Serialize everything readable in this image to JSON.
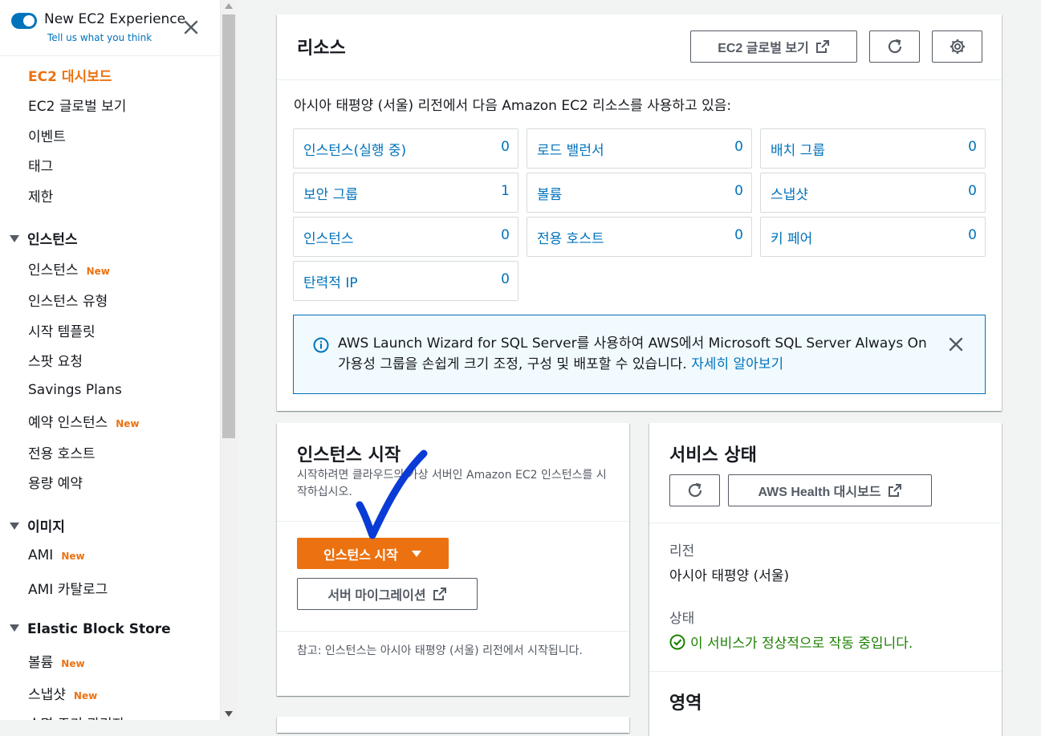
{
  "sidebar": {
    "experience_title": "New EC2 Experience",
    "experience_link": "Tell us what you think",
    "top_items": [
      "EC2 대시보드",
      "EC2 글로벌 보기",
      "이벤트",
      "태그",
      "제한"
    ],
    "section_instances": "인스턴스",
    "instances_items": [
      {
        "label": "인스턴스",
        "badge": "New"
      },
      {
        "label": "인스턴스 유형",
        "badge": ""
      },
      {
        "label": "시작 템플릿",
        "badge": ""
      },
      {
        "label": "스팟 요청",
        "badge": ""
      },
      {
        "label": "Savings Plans",
        "badge": ""
      },
      {
        "label": "예약 인스턴스",
        "badge": "New"
      },
      {
        "label": "전용 호스트",
        "badge": ""
      },
      {
        "label": "용량 예약",
        "badge": ""
      }
    ],
    "section_images": "이미지",
    "images_items": [
      {
        "label": "AMI",
        "badge": "New"
      },
      {
        "label": "AMI 카탈로그",
        "badge": ""
      }
    ],
    "section_ebs": "Elastic Block Store",
    "ebs_items": [
      {
        "label": "볼륨",
        "badge": "New"
      },
      {
        "label": "스냅샷",
        "badge": "New"
      },
      {
        "label": "수명 주기 관리자",
        "badge": ""
      }
    ]
  },
  "resources": {
    "title": "리소스",
    "global_view_button": "EC2 글로벌 보기",
    "description": "아시아 태평양 (서울) 리전에서 다음 Amazon EC2 리소스를 사용하고 있음:",
    "cells": [
      {
        "label": "인스턴스(실행 중)",
        "value": "0"
      },
      {
        "label": "로드 밸런서",
        "value": "0"
      },
      {
        "label": "배치 그룹",
        "value": "0"
      },
      {
        "label": "보안 그룹",
        "value": "1"
      },
      {
        "label": "볼륨",
        "value": "0"
      },
      {
        "label": "스냅샷",
        "value": "0"
      },
      {
        "label": "인스턴스",
        "value": "0"
      },
      {
        "label": "전용 호스트",
        "value": "0"
      },
      {
        "label": "키 페어",
        "value": "0"
      },
      {
        "label": "탄력적 IP",
        "value": "0"
      }
    ],
    "info_text": "AWS Launch Wizard for SQL Server를 사용하여 AWS에서 Microsoft SQL Server Always On 가용성 그룹을 손쉽게 크기 조정, 구성 및 배포할 수 있습니다.",
    "info_link": "자세히 알아보기"
  },
  "launch": {
    "title": "인스턴스 시작",
    "description": "시작하려면 클라우드의 가상 서버인 Amazon EC2 인스턴스를 시작하십시오.",
    "launch_button": "인스턴스 시작",
    "migration_button": "서버 마이그레이션",
    "note": "참고: 인스턴스는 아시아 태평양 (서울) 리전에서 시작됩니다."
  },
  "service_health": {
    "title": "서비스 상태",
    "health_button": "AWS Health 대시보드",
    "region_label": "리전",
    "region_value": "아시아 태평양 (서울)",
    "status_label": "상태",
    "status_value": "이 서비스가 정상적으로 작동 중입니다.",
    "status_color": "#1d8102"
  },
  "zones": {
    "title": "영역"
  },
  "colors": {
    "accent": "#ec7211",
    "link": "#0073bb",
    "annotation": "#0a3bd6"
  }
}
